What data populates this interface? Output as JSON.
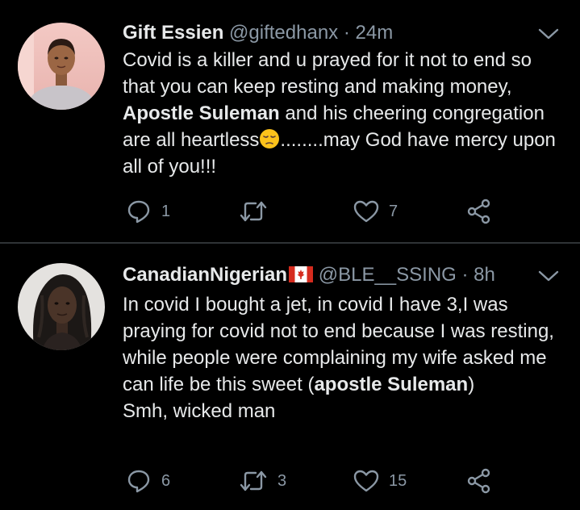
{
  "tweets": [
    {
      "name": "Gift Essien",
      "handle": "@giftedhanx",
      "separator": "·",
      "time": "24m",
      "text": {
        "p1": "Covid is a killer and u prayed for it not to end so that you can keep resting and making money, ",
        "bold1": "Apostle Suleman",
        "p2": " and his cheering congregation are all heartless",
        "emoji": "pensive-face-emoji",
        "p3": "........may God have mercy upon all of you!!!"
      },
      "replies": "1",
      "retweets": "",
      "likes": "7"
    },
    {
      "name": "CanadianNigerian",
      "flag": "canada-flag-emoji",
      "handle": "@BLE__SSING",
      "separator": "·",
      "time": "8h",
      "text": {
        "p1": "In covid I bought a jet, in covid I have 3,I was praying for covid not to end because I was resting,  while people were complaining my wife asked me can life be this sweet (",
        "bold1": "apostle Suleman",
        "p2": ")",
        "p3": "Smh, wicked man"
      },
      "replies": "6",
      "retweets": "3",
      "likes": "15"
    }
  ],
  "colors": {
    "background": "#000000",
    "text": "#e7e9ea",
    "secondary": "#8b98a5",
    "divider": "#2f3336"
  }
}
